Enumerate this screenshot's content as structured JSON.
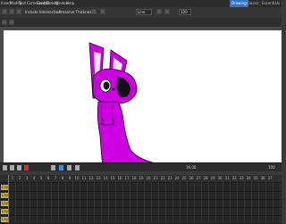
{
  "menubar": {
    "items": [
      "Insert",
      "Modify",
      "Text",
      "Commands",
      "Control",
      "Debug",
      "Window",
      "Help"
    ],
    "workspace_tabs": [
      "Drawing",
      "Classic",
      "Essentials"
    ],
    "active_workspace": "Drawing"
  },
  "toolbar": {
    "include_intersection": "Include Intersection",
    "preserve_thickness": "Preserve Thickness",
    "blend_mode": "Line",
    "zoom": "100"
  },
  "colors": {
    "character_fill": "#cc00e0",
    "character_ear_inner": "#f2e4f4",
    "accent": "#2f76c8",
    "playhead": "#1f8fff",
    "layer_label_bg": "#c6b04a"
  },
  "timeline": {
    "frame_numbers": [
      "1",
      "2",
      "3",
      "4",
      "5",
      "6",
      "7",
      "8",
      "9",
      "10",
      "11",
      "12",
      "13",
      "14",
      "15",
      "16",
      "17",
      "18",
      "19",
      "20",
      "21",
      "22",
      "23",
      "24",
      "25",
      "26",
      "27",
      "28",
      "29",
      "30",
      "31",
      "32",
      "33",
      "34",
      "35",
      "36",
      "37"
    ],
    "layers": [
      "Lay",
      "Lay",
      "Lay",
      "Lay",
      "Lay"
    ],
    "current_frame": 1
  },
  "playbar": {
    "frame_info": "16.00",
    "zoom_readout": "100"
  }
}
